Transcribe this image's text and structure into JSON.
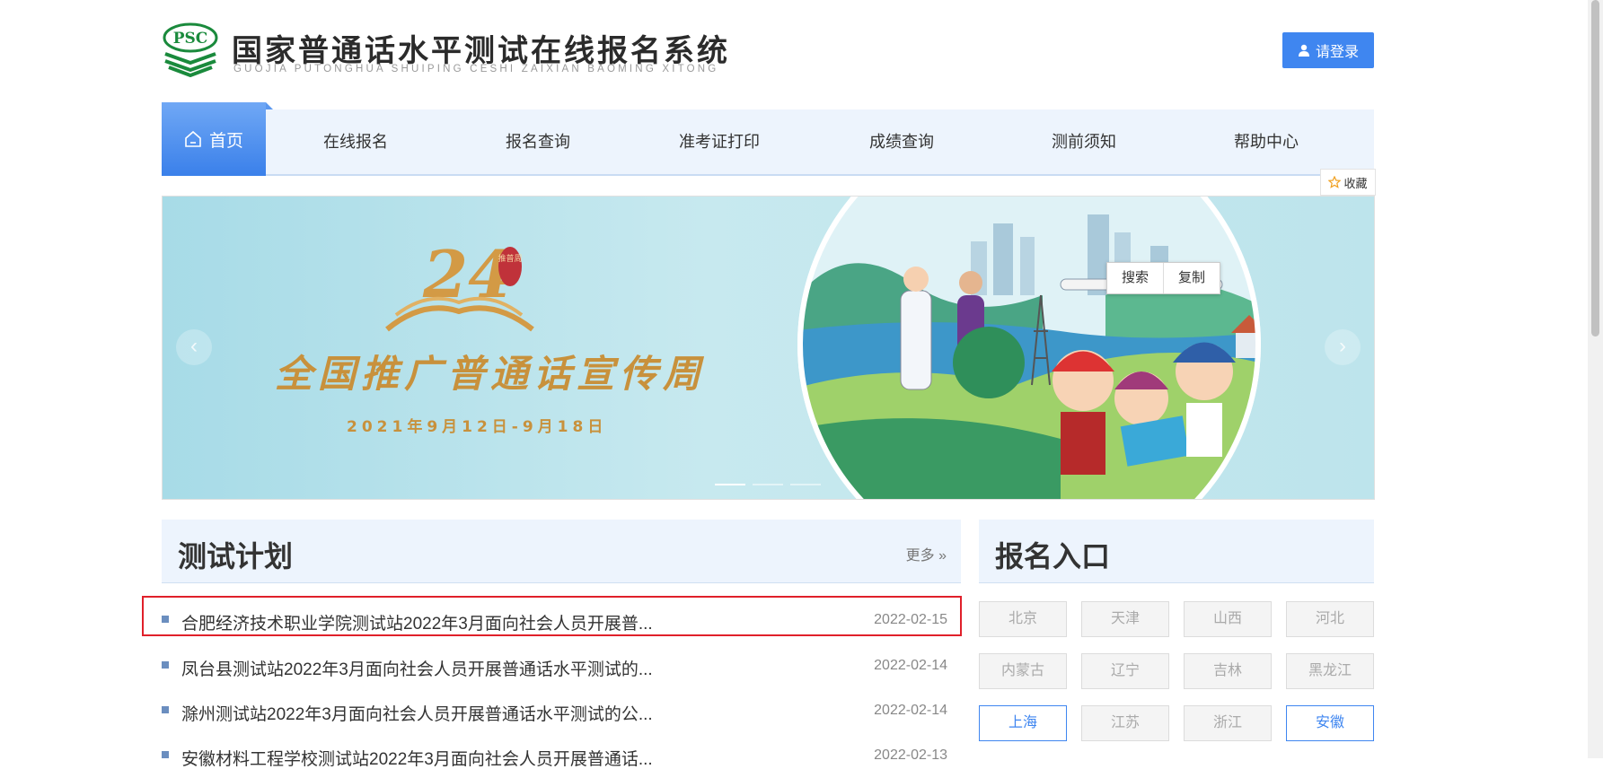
{
  "header": {
    "logo_text": "PSC",
    "title": "国家普通话水平测试在线报名系统",
    "subtitle": "GUOJIA PUTONGHUA SHUIPING CESHI ZAIXIAN BAOMING XITONG",
    "login_label": "请登录"
  },
  "nav": {
    "home": "首页",
    "items": [
      "在线报名",
      "报名查询",
      "准考证打印",
      "成绩查询",
      "测前须知",
      "帮助中心"
    ],
    "favorite": "收藏"
  },
  "banner": {
    "number": "24",
    "badge": "推普周",
    "headline": "全国推广普通话宣传周",
    "dates": "2021年9月12日-9月18日",
    "context_menu": [
      "搜索",
      "复制"
    ],
    "prev": "‹",
    "next": "›"
  },
  "plan": {
    "title": "测试计划",
    "more": "更多 »",
    "rows": [
      {
        "title": "合肥经济技术职业学院测试站2022年3月面向社会人员开展普...",
        "date": "2022-02-15"
      },
      {
        "title": "凤台县测试站2022年3月面向社会人员开展普通话水平测试的...",
        "date": "2022-02-14"
      },
      {
        "title": "滁州测试站2022年3月面向社会人员开展普通话水平测试的公...",
        "date": "2022-02-14"
      },
      {
        "title": "安徽材料工程学校测试站2022年3月面向社会人员开展普通话...",
        "date": "2022-02-13"
      }
    ]
  },
  "registration": {
    "title": "报名入口",
    "provinces": [
      "北京",
      "天津",
      "山西",
      "河北",
      "内蒙古",
      "辽宁",
      "吉林",
      "黑龙江",
      "上海",
      "江苏",
      "浙江",
      "安徽"
    ],
    "active": [
      "上海",
      "安徽"
    ]
  },
  "colors": {
    "primary": "#3f86f0",
    "nav_bg": "#edf4fd",
    "highlight": "#e0202a",
    "banner_text": "#c8913c"
  }
}
